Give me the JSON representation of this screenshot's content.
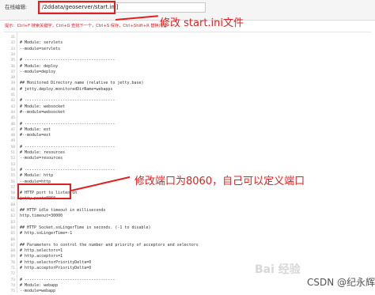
{
  "path_bar": {
    "label": "在线编辑:",
    "value": "/2ddata/geoserver/start.ini]"
  },
  "hint": "提示：Ctrl+F 搜索关键字，Ctrl+G 查找下一个，Ctrl+S 保存，Ctrl+Shift+R 替换内容",
  "annotations": {
    "file": "修改 start.ini文件",
    "port": "修改端口为8060，自己可以定义端口"
  },
  "editor": {
    "lines": [
      {
        "n": "31",
        "text": ""
      },
      {
        "n": "32",
        "text": "# Module: servlets"
      },
      {
        "n": "33",
        "text": "--module=servlets"
      },
      {
        "n": "34",
        "text": ""
      },
      {
        "n": "35",
        "text": "# --------------------------------------"
      },
      {
        "n": "36",
        "text": "# Module: deploy"
      },
      {
        "n": "37",
        "text": "--module=deploy"
      },
      {
        "n": "38",
        "text": ""
      },
      {
        "n": "39",
        "text": "## Monitored Directory name (relative to jetty.base)"
      },
      {
        "n": "40",
        "text": "# jetty.deploy.monitoredDirName=webapps"
      },
      {
        "n": "41",
        "text": ""
      },
      {
        "n": "42",
        "text": "# --------------------------------------"
      },
      {
        "n": "43",
        "text": "# Module: websocket"
      },
      {
        "n": "44",
        "text": "#--module=websocket"
      },
      {
        "n": "45",
        "text": ""
      },
      {
        "n": "46",
        "text": "# --------------------------------------"
      },
      {
        "n": "47",
        "text": "# Module: ext"
      },
      {
        "n": "48",
        "text": "#--module=ext"
      },
      {
        "n": "49",
        "text": ""
      },
      {
        "n": "50",
        "text": "# --------------------------------------"
      },
      {
        "n": "51",
        "text": "# Module: resources"
      },
      {
        "n": "52",
        "text": "--module=resources"
      },
      {
        "n": "53",
        "text": ""
      },
      {
        "n": "54",
        "text": "# --------------------------------------"
      },
      {
        "n": "55",
        "text": "# Module: http"
      },
      {
        "n": "56",
        "text": "--module=http"
      },
      {
        "n": "57",
        "text": ""
      },
      {
        "n": "58",
        "text": "# HTTP port to listen on"
      },
      {
        "n": "59",
        "text": "jetty.port=8060"
      },
      {
        "n": "60",
        "text": ""
      },
      {
        "n": "61",
        "text": "## HTTP idle timeout in milliseconds"
      },
      {
        "n": "62",
        "text": "http.timeout=30000"
      },
      {
        "n": "63",
        "text": ""
      },
      {
        "n": "64",
        "text": "## HTTP Socket.soLingerTime in seconds. (-1 to disable)"
      },
      {
        "n": "65",
        "text": "# http.soLingerTime=-1"
      },
      {
        "n": "66",
        "text": ""
      },
      {
        "n": "67",
        "text": "## Parameters to control the number and priority of acceptors and selectors"
      },
      {
        "n": "68",
        "text": "# http.selectors=1"
      },
      {
        "n": "69",
        "text": "# http.acceptors=1"
      },
      {
        "n": "70",
        "text": "# http.selectorPriorityDelta=0"
      },
      {
        "n": "71",
        "text": "# http.acceptorPriorityDelta=0"
      },
      {
        "n": "72",
        "text": ""
      },
      {
        "n": "73",
        "text": "# --------------------------------------"
      },
      {
        "n": "74",
        "text": "# Module: webapp"
      },
      {
        "n": "75",
        "text": "--module=webapp"
      }
    ]
  },
  "watermark": {
    "baidu": "Bai 经验",
    "csdn": "CSDN @纪永辉"
  },
  "colors": {
    "annotation": "#e02020",
    "hint": "#d02020"
  }
}
